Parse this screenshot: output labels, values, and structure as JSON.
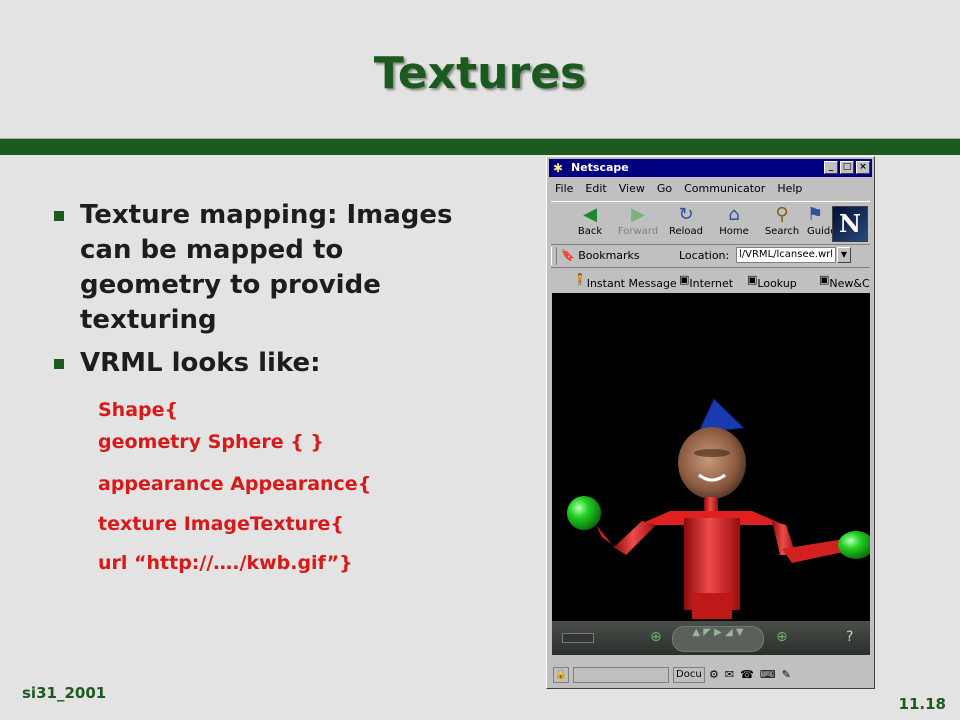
{
  "slide": {
    "title": "Textures",
    "bullets": [
      "Texture mapping: Images can be mapped to geometry to provide texturing",
      "VRML looks like:"
    ],
    "code_lines": [
      "Shape{",
      "geometry Sphere {  }",
      "appearance Appearance{",
      "texture ImageTexture{",
      "url “http://…./kwb.gif”}"
    ],
    "footer_left": "si31_2001",
    "footer_right": "11.18"
  },
  "browser": {
    "title": "Netscape",
    "menu": [
      "File",
      "Edit",
      "View",
      "Go",
      "Communicator",
      "Help"
    ],
    "toolbar": [
      {
        "label": "Back",
        "icon": "back-arrow-icon",
        "enabled": true
      },
      {
        "label": "Forward",
        "icon": "forward-arrow-icon",
        "enabled": false
      },
      {
        "label": "Reload",
        "icon": "reload-icon",
        "enabled": true
      },
      {
        "label": "Home",
        "icon": "home-icon",
        "enabled": true
      },
      {
        "label": "Search",
        "icon": "search-icon",
        "enabled": true
      },
      {
        "label": "Guide",
        "icon": "guide-icon",
        "enabled": true
      }
    ],
    "bookmarks_label": "Bookmarks",
    "location_label": "Location:",
    "location_value": "l/VRML/lcansee.wrl",
    "personal_bar": [
      "Instant Message",
      "Internet",
      "Lookup",
      "New&C"
    ],
    "status_doc": "Docu",
    "colors": {
      "titlebar": "#000080",
      "body_red": "#e02020",
      "hat_blue": "#1a3ab0",
      "hand_green": "#1fc41f"
    }
  }
}
